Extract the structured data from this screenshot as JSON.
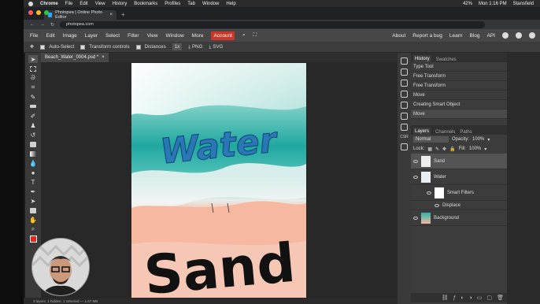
{
  "menubar": {
    "app": "Chrome",
    "items": [
      "File",
      "Edit",
      "View",
      "History",
      "Bookmarks",
      "Profiles",
      "Tab",
      "Window",
      "Help"
    ],
    "battery": "42%",
    "clock": "Mon 1:16 PM",
    "user": "Stansfield"
  },
  "browser": {
    "tab_title": "Photopea | Online Photo Editor",
    "new_tab": "+",
    "url": "photopea.com"
  },
  "pp_menu": {
    "items": [
      "File",
      "Edit",
      "Image",
      "Layer",
      "Select",
      "Filter",
      "View",
      "Window",
      "More"
    ],
    "account": "Account",
    "right": [
      "About",
      "Report a bug",
      "Learn",
      "Blog",
      "API"
    ]
  },
  "options": {
    "auto_select": "Auto-Select",
    "transform_controls": "Transform controls",
    "distances": "Distances",
    "zoom": "1x",
    "png": "PNG",
    "svg": "SVG"
  },
  "document": {
    "tab": "Beach_Water_0004.psd *",
    "close": "×",
    "water_text": "Water",
    "sand_text": "Sand"
  },
  "history": {
    "tabs": [
      "History",
      "Swatches"
    ],
    "items": [
      "Type Tool",
      "Free Transform",
      "Free Transform",
      "Move",
      "Creating Smart Object",
      "Move"
    ]
  },
  "right_icons": {
    "csr": "CSR"
  },
  "layers": {
    "tabs": [
      "Layers",
      "Channels",
      "Paths"
    ],
    "blend": "Normal",
    "opacity_label": "Opacity:",
    "opacity": "100%",
    "lock_label": "Lock:",
    "fill_label": "Fill:",
    "fill": "100%",
    "items": [
      {
        "name": "Sand"
      },
      {
        "name": "Water"
      },
      {
        "name": "Smart Filters"
      },
      {
        "name": "Displace"
      },
      {
        "name": "Background"
      }
    ]
  },
  "status": "3 layers, 1 hidden, 1 selected — 1.67 MB",
  "colors": {
    "accent": "#c8382a",
    "fg_swatch": "#e8251b"
  }
}
